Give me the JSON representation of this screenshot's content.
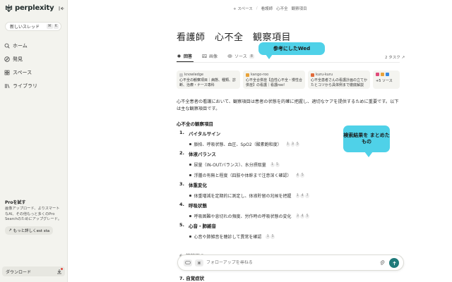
{
  "sidebar": {
    "brand": "perplexity",
    "new_thread": "新しいスレッド",
    "new_thread_keys": [
      "⌘",
      "K"
    ],
    "nav": [
      {
        "label": "ホーム",
        "icon": "search-icon"
      },
      {
        "label": "発見",
        "icon": "compass-icon"
      },
      {
        "label": "スペース",
        "icon": "grid-icon"
      },
      {
        "label": "ライブラリ",
        "icon": "library-icon"
      }
    ],
    "pro": {
      "title": "Proを試す",
      "desc": "画像アップロード、よりスマートなAI、その他もっと多くのPro Searchのためにアップグレード。",
      "button": "もっと詳しくest sta"
    },
    "download": "ダウンロード"
  },
  "topbar": {
    "add_space": "+ スペース",
    "breadcrumb": [
      "看護師",
      "心不全",
      "観察項目"
    ]
  },
  "main": {
    "title": "看護師　心不全　観察項目",
    "tabs": [
      {
        "label": "回答",
        "icon": "answer-icon"
      },
      {
        "label": "画像",
        "icon": "image-icon"
      },
      {
        "label": "ソース",
        "icon": "sources-icon",
        "badge": "8"
      }
    ],
    "task": "2 タスク"
  },
  "callouts": {
    "web_ref": "参考にしたWed",
    "summary": "検索結果を まとめたもの"
  },
  "sources": [
    {
      "site": "knowledge",
      "text": "心不全の観察項目｜病態、種類、診断、治療・ナース専科",
      "color": "#c9c9c9"
    },
    {
      "site": "kango-roo",
      "text": "心不全合併症【血性心不全・慢性合併症】の看護｜看護roo!",
      "color": "#e8a23a"
    },
    {
      "site": "kuru-kuru",
      "text": "心不全患者さんの看護計画の立てかたとコツから具体例まで徹底解説",
      "color": "#e06a3a"
    },
    {
      "site": "+5 ソース",
      "text": "",
      "color": "#e04a7a"
    }
  ],
  "content": {
    "intro": "心不全患者の看護において、観察項目は患者の状態を的確に把握し、適切なケアを提供するために重要です。以下は主な観察項目です。",
    "heading": "心不全の観察項目",
    "items": [
      {
        "num": "1.",
        "title": "バイタルサイン",
        "bullets": [
          {
            "text": "脈拍、呼吸状態、血圧、SpO2（酸素飽和度）",
            "cites": [
              "1",
              "3",
              "5"
            ]
          }
        ]
      },
      {
        "num": "2.",
        "title": "体液バランス",
        "bullets": [
          {
            "text": "尿量（IN-OUTバランス）、水分摂取量",
            "cites": [
              "1",
              "5"
            ]
          },
          {
            "text": "浮腫の有無と程度（四肢や体幹まで注意深く確認）",
            "cites": [
              "4",
              "5"
            ]
          }
        ]
      },
      {
        "num": "3.",
        "title": "体重変化",
        "bullets": [
          {
            "text": "体重増減を定期的に測定し、体液貯留の兆候を把握",
            "cites": [
              "1",
              "4",
              "7"
            ]
          }
        ]
      },
      {
        "num": "4.",
        "title": "呼吸状態",
        "bullets": [
          {
            "text": "呼吸困難や息切れの頻度、労作時の呼吸状態の変化",
            "cites": [
              "3",
              "4",
              "5"
            ]
          }
        ]
      },
      {
        "num": "5.",
        "title": "心音・肺雑音",
        "bullets": [
          {
            "text": "心音や肺雑音を聴診して異常を確認",
            "cites": [
              "1",
              "5"
            ]
          }
        ]
      }
    ],
    "partial_item": "6. 精神面の",
    "last_item": "7. 自覚症状"
  },
  "followup": {
    "placeholder": "フォローアップを尋ねる"
  },
  "colors": {
    "accent": "#1f7a7a",
    "callout": "#4fd1e8",
    "sidebar_bg": "#f3f3ee"
  }
}
